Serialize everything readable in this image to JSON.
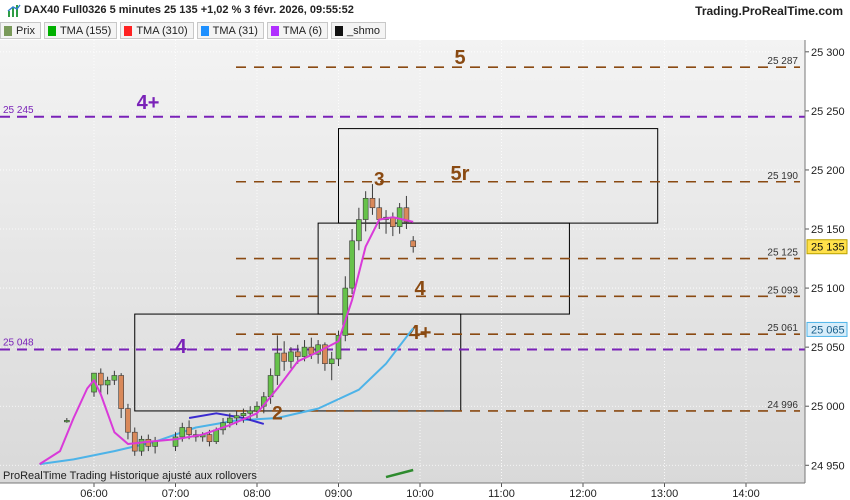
{
  "header": {
    "title": "DAX40 Full0326 5 minutes 25 135 +1,02 % 3 févr. 2026, 09:55:52",
    "brand": "Trading.ProRealTime.com"
  },
  "legend": [
    {
      "label": "Prix",
      "color": "#7a9a5a"
    },
    {
      "label": "TMA (155)",
      "color": "#00b000"
    },
    {
      "label": "TMA (310)",
      "color": "#ff2222"
    },
    {
      "label": "TMA (31)",
      "color": "#1e90ff"
    },
    {
      "label": "TMA (6)",
      "color": "#b030ff"
    },
    {
      "label": "_shmo",
      "color": "#111111"
    }
  ],
  "footer_note": "ProRealTime Trading  Historique ajusté aux rollovers",
  "chart_data": {
    "type": "candlestick",
    "x_ticks": [
      "06:00",
      "07:00",
      "08:00",
      "09:00",
      "10:00",
      "11:00",
      "12:00",
      "13:00",
      "14:00"
    ],
    "y_ticks": [
      "24 950",
      "25 000",
      "25 050",
      "25 100",
      "25 150",
      "25 200",
      "25 250",
      "25 300"
    ],
    "y_range": [
      24935,
      25310
    ],
    "grid": true,
    "last_price": {
      "label": "25 135",
      "value": 25135
    },
    "tma31_label": {
      "label": "25 065",
      "value": 25065
    },
    "levels_brown": [
      {
        "value": 25287,
        "label": "25 287",
        "big_label": "5"
      },
      {
        "value": 25190,
        "label": "25 190",
        "big_label": "5r"
      },
      {
        "value": 25125,
        "label": "25 125",
        "big_label": ""
      },
      {
        "value": 25093,
        "label": "25 093",
        "big_label": "4"
      },
      {
        "value": 25061,
        "label": "25 061",
        "big_label": "4+"
      },
      {
        "value": 24996,
        "label": "24 996",
        "big_label": ""
      }
    ],
    "levels_purple": [
      {
        "value": 25245,
        "label": "25 245",
        "big_label": "4+"
      },
      {
        "value": 25048,
        "label": "25 048",
        "big_label": "4"
      }
    ],
    "wave_labels": [
      {
        "text": "3",
        "time": "09:30",
        "value": 25192
      },
      {
        "text": "2",
        "time": "08:15",
        "value": 24994
      }
    ],
    "boxes": [
      {
        "t1": "06:30",
        "t2": "10:30",
        "v1": 24996,
        "v2": 25078
      },
      {
        "t1": "08:45",
        "t2": "11:50",
        "v1": 25078,
        "v2": 25155
      },
      {
        "t1": "09:00",
        "t2": "12:55",
        "v1": 25155,
        "v2": 25235
      }
    ],
    "candles": [
      {
        "t": "05:40",
        "o": 24988,
        "h": 24990,
        "l": 24986,
        "c": 24988
      },
      {
        "t": "06:00",
        "o": 25012,
        "h": 25020,
        "l": 25008,
        "c": 25028
      },
      {
        "t": "06:05",
        "o": 25028,
        "h": 25032,
        "l": 25010,
        "c": 25018
      },
      {
        "t": "06:10",
        "o": 25018,
        "h": 25025,
        "l": 25010,
        "c": 25022
      },
      {
        "t": "06:15",
        "o": 25022,
        "h": 25030,
        "l": 25018,
        "c": 25026
      },
      {
        "t": "06:20",
        "o": 25026,
        "h": 25028,
        "l": 24990,
        "c": 24998
      },
      {
        "t": "06:25",
        "o": 24998,
        "h": 25002,
        "l": 24972,
        "c": 24978
      },
      {
        "t": "06:30",
        "o": 24978,
        "h": 24982,
        "l": 24958,
        "c": 24962
      },
      {
        "t": "06:35",
        "o": 24962,
        "h": 24975,
        "l": 24958,
        "c": 24972
      },
      {
        "t": "06:40",
        "o": 24972,
        "h": 24976,
        "l": 24962,
        "c": 24966
      },
      {
        "t": "06:45",
        "o": 24966,
        "h": 24974,
        "l": 24960,
        "c": 24970
      },
      {
        "t": "07:00",
        "o": 24966,
        "h": 24978,
        "l": 24962,
        "c": 24974
      },
      {
        "t": "07:05",
        "o": 24974,
        "h": 24986,
        "l": 24970,
        "c": 24982
      },
      {
        "t": "07:10",
        "o": 24982,
        "h": 24988,
        "l": 24972,
        "c": 24976
      },
      {
        "t": "07:15",
        "o": 24976,
        "h": 24980,
        "l": 24970,
        "c": 24974
      },
      {
        "t": "07:20",
        "o": 24974,
        "h": 24978,
        "l": 24970,
        "c": 24976
      },
      {
        "t": "07:25",
        "o": 24976,
        "h": 24980,
        "l": 24966,
        "c": 24970
      },
      {
        "t": "07:30",
        "o": 24970,
        "h": 24982,
        "l": 24968,
        "c": 24980
      },
      {
        "t": "07:35",
        "o": 24980,
        "h": 24990,
        "l": 24976,
        "c": 24986
      },
      {
        "t": "07:40",
        "o": 24986,
        "h": 24994,
        "l": 24982,
        "c": 24990
      },
      {
        "t": "07:45",
        "o": 24990,
        "h": 24996,
        "l": 24984,
        "c": 24992
      },
      {
        "t": "07:50",
        "o": 24992,
        "h": 24998,
        "l": 24986,
        "c": 24994
      },
      {
        "t": "07:55",
        "o": 24994,
        "h": 25000,
        "l": 24988,
        "c": 24996
      },
      {
        "t": "08:00",
        "o": 24996,
        "h": 25004,
        "l": 24990,
        "c": 25000
      },
      {
        "t": "08:05",
        "o": 25000,
        "h": 25012,
        "l": 24994,
        "c": 25008
      },
      {
        "t": "08:10",
        "o": 25008,
        "h": 25032,
        "l": 25002,
        "c": 25026
      },
      {
        "t": "08:15",
        "o": 25026,
        "h": 25060,
        "l": 25018,
        "c": 25045
      },
      {
        "t": "08:20",
        "o": 25045,
        "h": 25055,
        "l": 25030,
        "c": 25038
      },
      {
        "t": "08:25",
        "o": 25038,
        "h": 25050,
        "l": 25032,
        "c": 25046
      },
      {
        "t": "08:30",
        "o": 25046,
        "h": 25052,
        "l": 25036,
        "c": 25042
      },
      {
        "t": "08:35",
        "o": 25042,
        "h": 25056,
        "l": 25038,
        "c": 25050
      },
      {
        "t": "08:40",
        "o": 25050,
        "h": 25058,
        "l": 25040,
        "c": 25044
      },
      {
        "t": "08:45",
        "o": 25044,
        "h": 25056,
        "l": 25036,
        "c": 25052
      },
      {
        "t": "08:50",
        "o": 25052,
        "h": 25054,
        "l": 25030,
        "c": 25036
      },
      {
        "t": "08:55",
        "o": 25036,
        "h": 25046,
        "l": 25022,
        "c": 25040
      },
      {
        "t": "09:00",
        "o": 25040,
        "h": 25064,
        "l": 25034,
        "c": 25060
      },
      {
        "t": "09:05",
        "o": 25060,
        "h": 25110,
        "l": 25055,
        "c": 25100
      },
      {
        "t": "09:10",
        "o": 25100,
        "h": 25150,
        "l": 25095,
        "c": 25140
      },
      {
        "t": "09:15",
        "o": 25140,
        "h": 25168,
        "l": 25132,
        "c": 25158
      },
      {
        "t": "09:20",
        "o": 25158,
        "h": 25182,
        "l": 25148,
        "c": 25176
      },
      {
        "t": "09:25",
        "o": 25176,
        "h": 25188,
        "l": 25162,
        "c": 25168
      },
      {
        "t": "09:30",
        "o": 25168,
        "h": 25176,
        "l": 25150,
        "c": 25158
      },
      {
        "t": "09:35",
        "o": 25158,
        "h": 25166,
        "l": 25146,
        "c": 25160
      },
      {
        "t": "09:40",
        "o": 25160,
        "h": 25164,
        "l": 25144,
        "c": 25152
      },
      {
        "t": "09:45",
        "o": 25152,
        "h": 25172,
        "l": 25146,
        "c": 25168
      },
      {
        "t": "09:50",
        "o": 25168,
        "h": 25178,
        "l": 25150,
        "c": 25156
      },
      {
        "t": "09:55",
        "o": 25140,
        "h": 25144,
        "l": 25130,
        "c": 25135
      }
    ],
    "tma6": [
      [
        5.333,
        24951
      ],
      [
        5.583,
        24962
      ],
      [
        5.75,
        24990
      ],
      [
        5.917,
        25015
      ],
      [
        6.0,
        25022
      ],
      [
        6.083,
        25010
      ],
      [
        6.25,
        24978
      ],
      [
        6.417,
        24968
      ],
      [
        6.667,
        24970
      ],
      [
        7.0,
        24972
      ],
      [
        7.333,
        24976
      ],
      [
        7.667,
        24984
      ],
      [
        8.0,
        24994
      ],
      [
        8.25,
        25015
      ],
      [
        8.5,
        25038
      ],
      [
        8.75,
        25046
      ],
      [
        9.0,
        25055
      ],
      [
        9.167,
        25090
      ],
      [
        9.333,
        25135
      ],
      [
        9.5,
        25158
      ],
      [
        9.667,
        25160
      ],
      [
        9.917,
        25156
      ]
    ],
    "tma31": [
      [
        5.333,
        24951
      ],
      [
        5.75,
        24955
      ],
      [
        6.25,
        24962
      ],
      [
        6.75,
        24970
      ],
      [
        7.25,
        24982
      ],
      [
        7.75,
        24988
      ],
      [
        8.25,
        24990
      ],
      [
        8.75,
        24998
      ],
      [
        9.25,
        25014
      ],
      [
        9.583,
        25036
      ],
      [
        9.917,
        25066
      ]
    ],
    "shmo": [
      [
        7.167,
        24990
      ],
      [
        7.5,
        24994
      ],
      [
        7.833,
        24990
      ],
      [
        8.083,
        24985
      ]
    ],
    "tma155": [
      [
        9.583,
        24940
      ],
      [
        9.917,
        24946
      ]
    ]
  }
}
